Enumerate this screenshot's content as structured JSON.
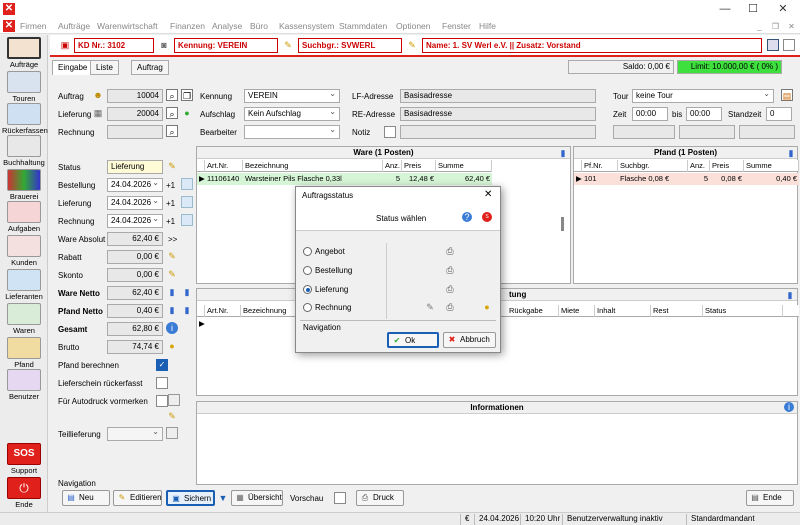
{
  "window": {
    "minimize": "—",
    "maximize": "☐",
    "close": "✕",
    "mdi_min": "_",
    "mdi_max": "❐",
    "mdi_close": "✕"
  },
  "menu": [
    "Firmen",
    "Aufträge",
    "Warenwirtschaft",
    "Finanzen",
    "Analyse",
    "Büro",
    "Kassensystem",
    "Stammdaten",
    "Optionen",
    "Fenster",
    "Hilfe"
  ],
  "sidebar": [
    "Aufträge",
    "Touren",
    "Rückerfassen",
    "Buchhaltung",
    "Brauerei",
    "Aufgaben",
    "Kunden",
    "Lieferanten",
    "Waren",
    "Pfand",
    "Benutzer",
    "Support",
    "Ende"
  ],
  "sos": "SOS",
  "header": {
    "kd": "KD Nr.: 3102",
    "kennung": "Kennung: VEREIN",
    "suchbgr": "Suchbgr.: SVWERL",
    "name": "Name: 1. SV Werl e.V. || Zusatz: Vorstand"
  },
  "tabs": {
    "eingabe": "Eingabe",
    "liste": "Liste",
    "auftrag": "Auftrag"
  },
  "saldo": "Saldo: 0,00 €",
  "limit": "Limit: 10.000,00 € ( 0% )",
  "form": {
    "auftrag_l": "Auftrag",
    "auftrag": "10004",
    "lieferung_l": "Lieferung",
    "lieferung": "20004",
    "rechnung_l": "Rechnung",
    "kennung_l": "Kennung",
    "kennung": "VEREIN",
    "aufschlag_l": "Aufschlag",
    "aufschlag": "Kein Aufschlag",
    "bearbeiter_l": "Bearbeiter",
    "lf_l": "LF-Adresse",
    "lf": "Basisadresse",
    "re_l": "RE-Adresse",
    "re": "Basisadresse",
    "notiz_l": "Notiz",
    "tour_l": "Tour",
    "tour": "keine Tour",
    "zeit_l": "Zeit",
    "zeit_von": "00:00",
    "bis_l": "bis",
    "zeit_bis": "00:00",
    "standzeit_l": "Standzeit",
    "standzeit": "0",
    "status_l": "Status",
    "status": "Lieferung",
    "bestellung_l": "Bestellung",
    "bestellung": "24.04.2026",
    "lieferung2_l": "Lieferung",
    "lieferung2": "24.04.2026",
    "rechnung2_l": "Rechnung",
    "rechnung2": "24.04.2026",
    "plus1": "+1",
    "ware_absolut_l": "Ware Absolut",
    "ware_absolut": "62,40 €",
    "arrows": ">>",
    "rabatt_l": "Rabatt",
    "rabatt": "0,00 €",
    "skonto_l": "Skonto",
    "skonto": "0,00 €",
    "ware_netto_l": "Ware Netto",
    "ware_netto": "62,40 €",
    "pfand_netto_l": "Pfand Netto",
    "pfand_netto": "0,40 €",
    "gesamt_l": "Gesamt",
    "gesamt": "62,80 €",
    "brutto_l": "Brutto",
    "brutto": "74,74 €",
    "pfand_berechnen": "Pfand berechnen",
    "lieferschein": "Lieferschein rückerfasst",
    "autodruck": "Für Autodruck vormerken",
    "teillieferung": "Teillieferung"
  },
  "ware": {
    "title": "Ware (1 Posten)",
    "cols": [
      "Art.Nr.",
      "Bezeichnung",
      "Anz.",
      "Preis",
      "Summe"
    ],
    "rows": [
      [
        "11106140",
        "Warsteiner Pils Flasche 0,33l",
        "5",
        "12,48 €",
        "62,40 €"
      ]
    ]
  },
  "pfand": {
    "title": "Pfand (1 Posten)",
    "cols": [
      "Pf.Nr.",
      "Suchbgr.",
      "Anz.",
      "Preis",
      "Summe"
    ],
    "rows": [
      [
        "101",
        "Flasche 0,08 €",
        "5",
        "0,08 €",
        "0,40 €"
      ]
    ]
  },
  "lower": {
    "title_suffix": "tung",
    "cols": [
      "Art.Nr.",
      "Bezeichnung"
    ],
    "right_cols": [
      "Rückgabe",
      "Miete",
      "Inhalt",
      "Rest",
      "Status"
    ]
  },
  "info": {
    "title": "Informationen"
  },
  "navigation": "Navigation",
  "buttons": {
    "neu": "Neu",
    "editieren": "Editieren",
    "sichern": "Sichern",
    "uebersicht": "Übersicht",
    "vorschau": "Vorschau",
    "druck": "Druck",
    "ende": "Ende"
  },
  "status_bar": {
    "currency": "€",
    "date": "24.04.2026",
    "time": "10:20 Uhr",
    "user": "Benutzerverwaltung inaktiv",
    "mandant": "Standardmandant"
  },
  "dialog": {
    "title": "Auftragsstatus",
    "subtitle": "Status wählen",
    "options": [
      "Angebot",
      "Bestellung",
      "Lieferung",
      "Rechnung"
    ],
    "selected": "Lieferung",
    "navigation": "Navigation",
    "ok": "Ok",
    "abbruch": "Abbruch"
  }
}
